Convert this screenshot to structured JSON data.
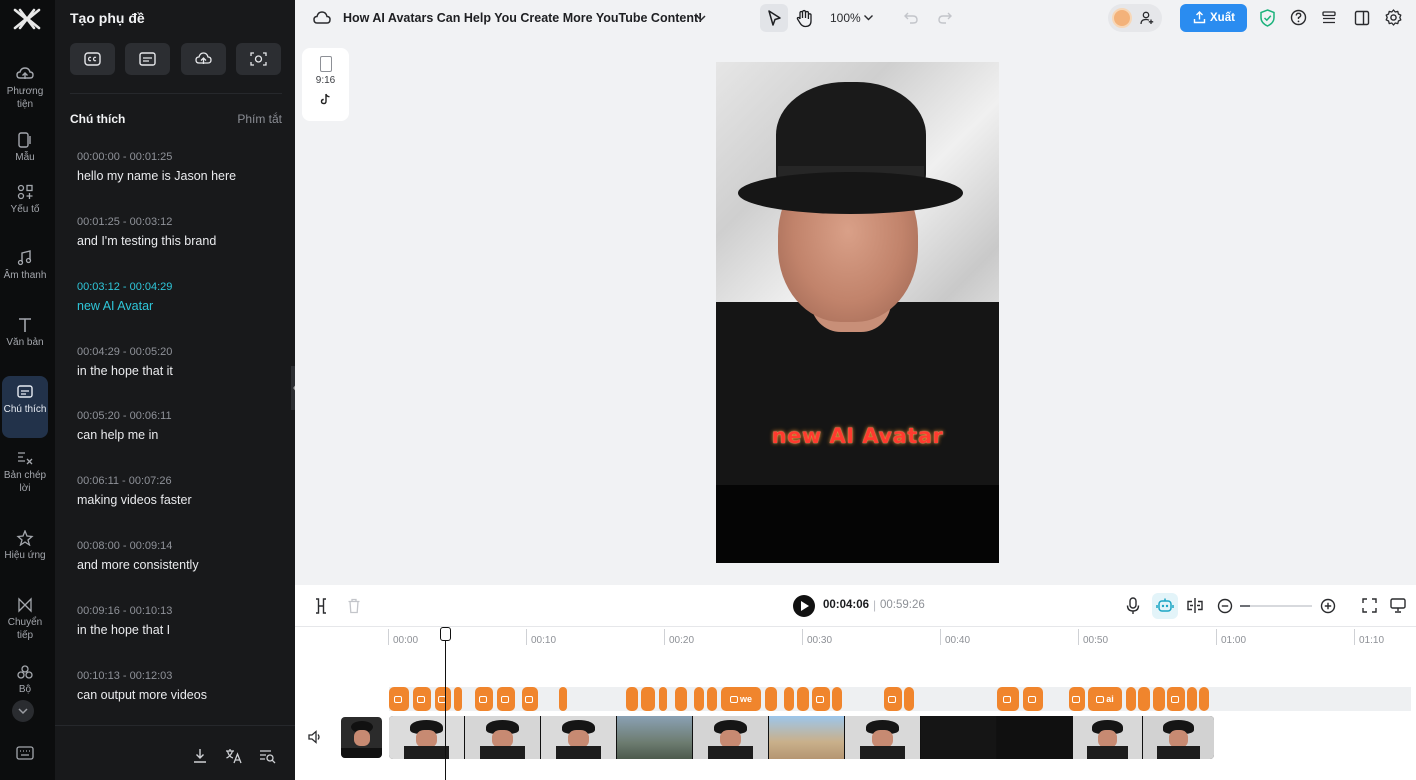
{
  "rail": {
    "items": [
      {
        "label": "Phương tiện",
        "icon": "cloud-upload-icon"
      },
      {
        "label": "Mẫu",
        "icon": "template-icon"
      },
      {
        "label": "Yếu tố",
        "icon": "elements-icon"
      },
      {
        "label": "Âm thanh",
        "icon": "music-note-icon"
      },
      {
        "label": "Văn bản",
        "icon": "text-icon"
      },
      {
        "label": "Chú thích",
        "icon": "captions-icon",
        "active": true
      },
      {
        "label": "Bản chép lời",
        "icon": "transcript-icon"
      },
      {
        "label": "Hiệu ứng",
        "icon": "effects-icon"
      },
      {
        "label": "Chuyển tiếp",
        "icon": "transition-icon"
      },
      {
        "label": "Bộ",
        "icon": "plugins-icon"
      }
    ]
  },
  "panel": {
    "title": "Tạo phụ đề",
    "section_title": "Chú thích",
    "shortcut_label": "Phím tắt",
    "captions": [
      {
        "time": "00:00:00 - 00:01:25",
        "text": "hello my name is Jason here"
      },
      {
        "time": "00:01:25 - 00:03:12",
        "text": "and I'm testing this brand"
      },
      {
        "time": "00:03:12 - 00:04:29",
        "text": "new AI Avatar",
        "active": true
      },
      {
        "time": "00:04:29 - 00:05:20",
        "text": "in the hope that it"
      },
      {
        "time": "00:05:20 - 00:06:11",
        "text": "can help me in"
      },
      {
        "time": "00:06:11 - 00:07:26",
        "text": "making videos faster"
      },
      {
        "time": "00:08:00 - 00:09:14",
        "text": "and more consistently"
      },
      {
        "time": "00:09:16 - 00:10:13",
        "text": "in the hope that I"
      },
      {
        "time": "00:10:13 - 00:12:03",
        "text": "can output more videos"
      }
    ]
  },
  "topbar": {
    "project_title": "How AI Avatars Can Help You Create More YouTube Content!",
    "zoom": "100%",
    "export_label": "Xuất",
    "accent_color": "#2a8cf0"
  },
  "canvas": {
    "ratio_label": "9:16",
    "subtitle_overlay": "new AI Avatar",
    "subtitle_color": "#ff3b2f"
  },
  "player": {
    "current_time": "00:04:06",
    "total_time": "00:59:26"
  },
  "timeline": {
    "ticks": [
      "00:00",
      "00:10",
      "00:20",
      "00:30",
      "00:40",
      "00:50",
      "01:00",
      "01:10"
    ],
    "chip_labels": {
      "we": "we",
      "ai": "ai"
    },
    "caption_chip_color": "#f0852d"
  }
}
